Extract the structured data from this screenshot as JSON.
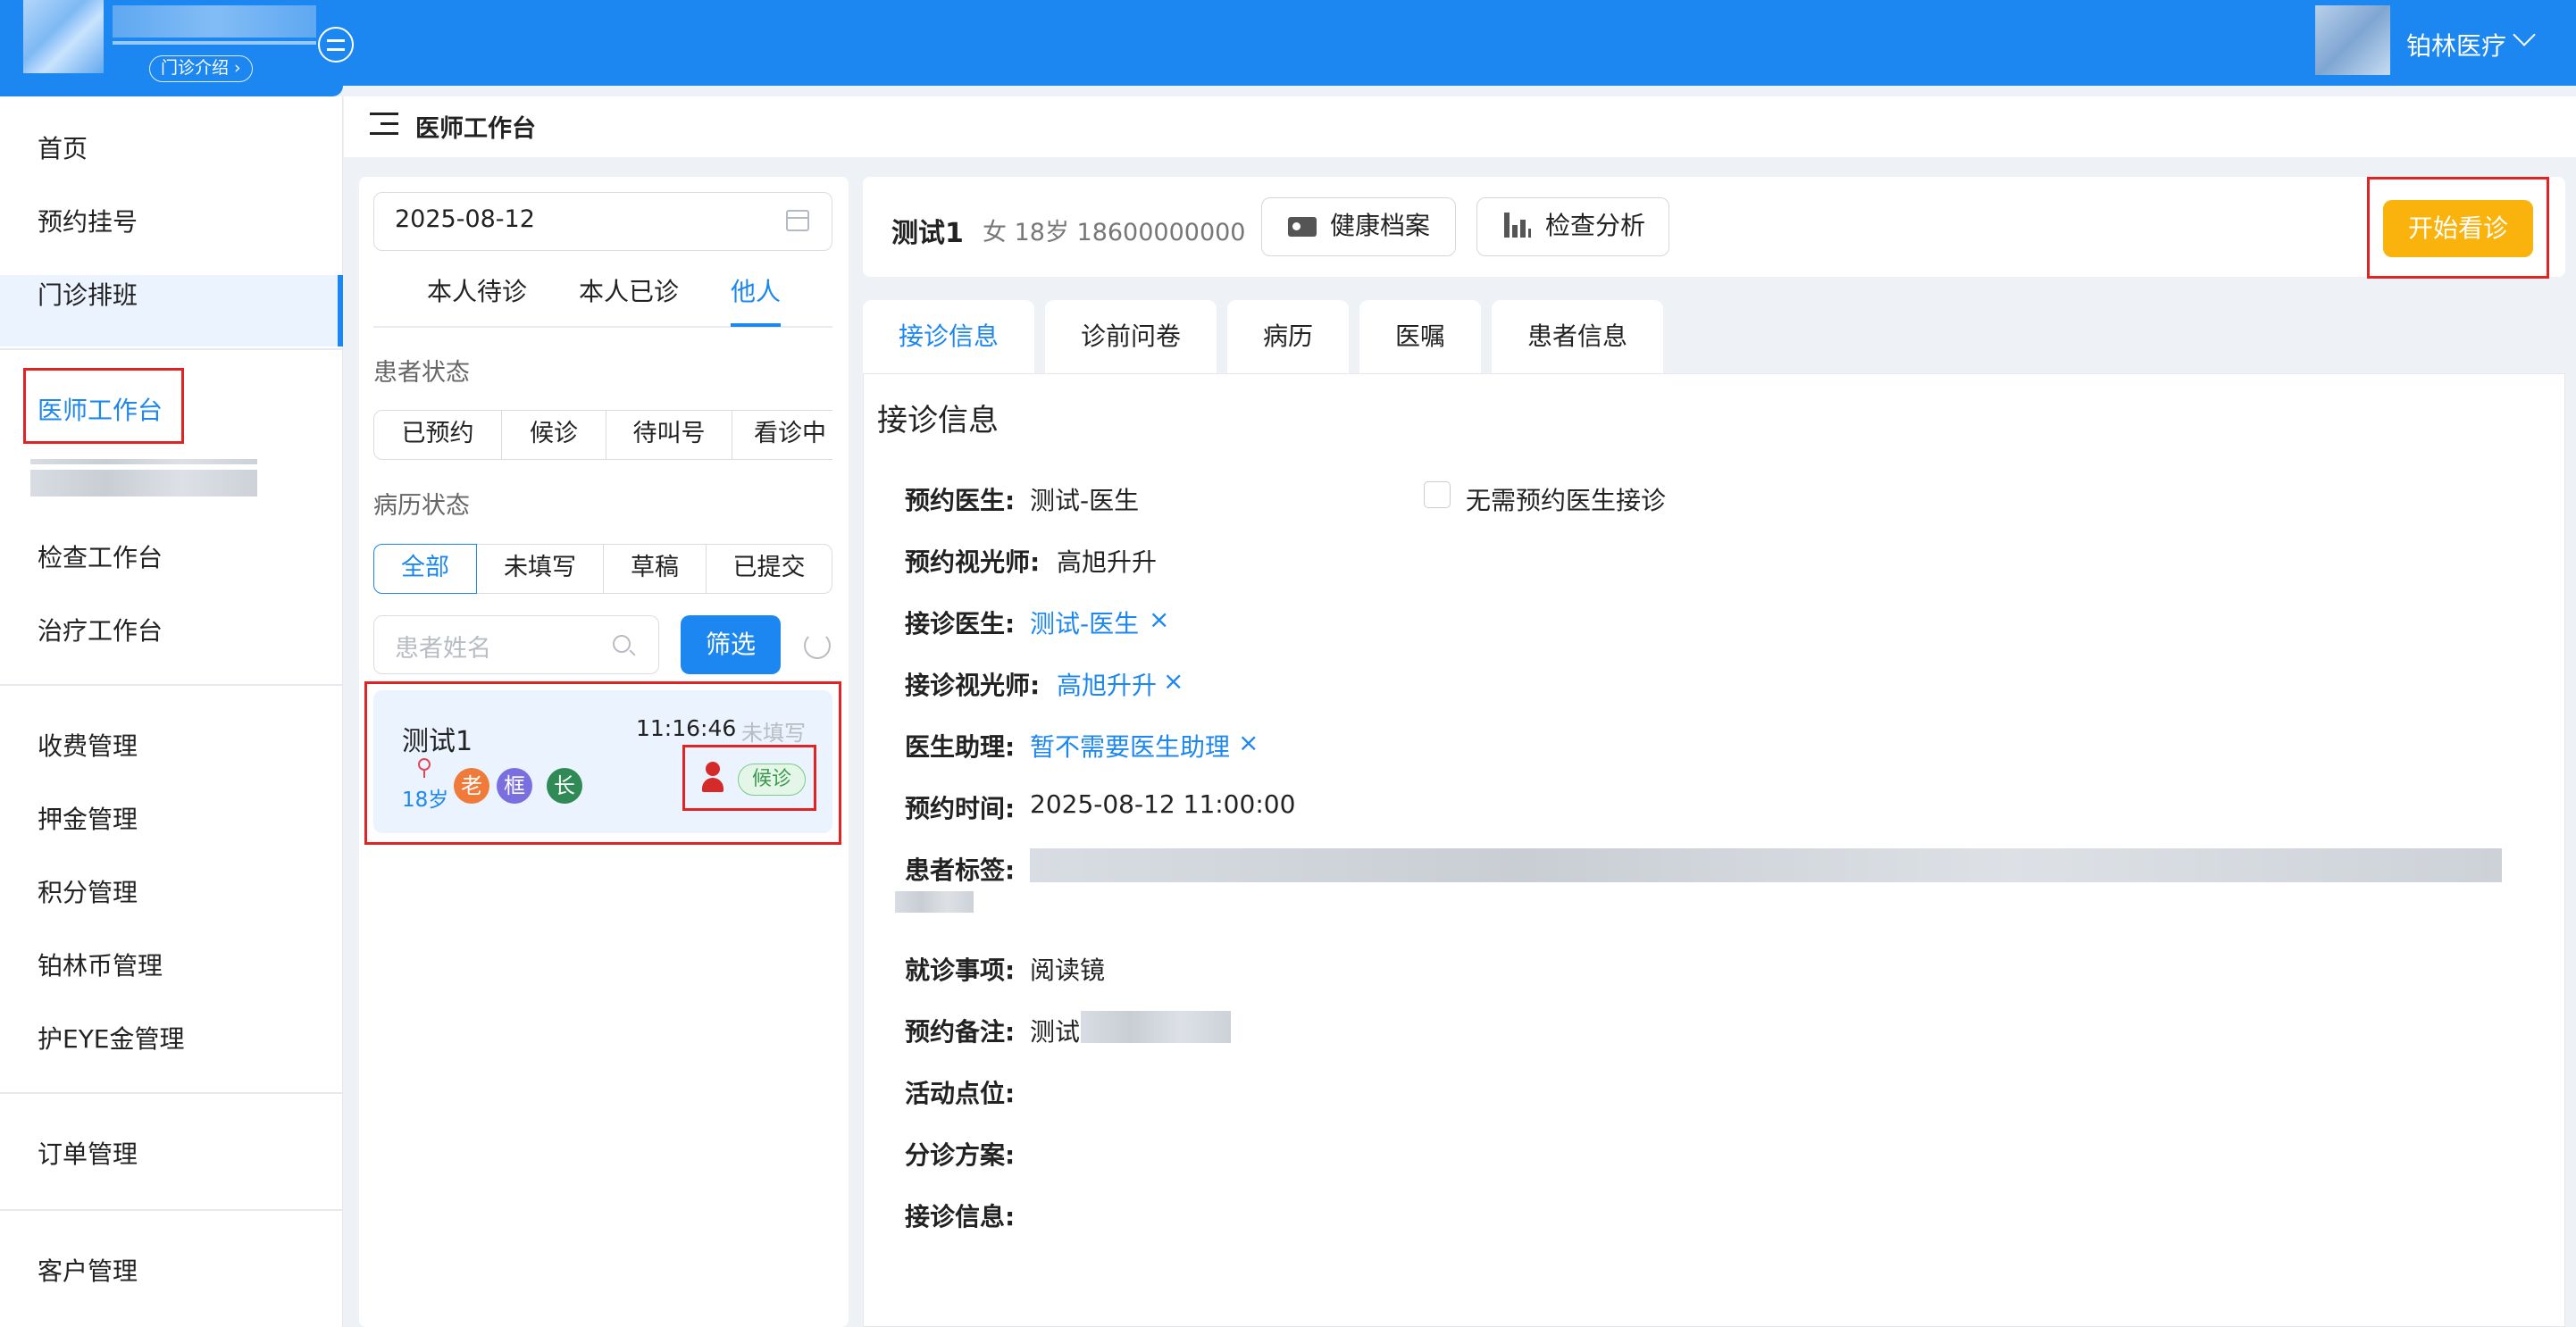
{
  "header": {
    "clinic_intro": "门诊介绍",
    "org_name": "铂林医疗"
  },
  "sidebar": {
    "items": [
      "首页",
      "预约挂号",
      "门诊排班",
      "医师工作台",
      "检查工作台",
      "治疗工作台",
      "收费管理",
      "押金管理",
      "积分管理",
      "铂林币管理",
      "护EYE金管理",
      "订单管理",
      "客户管理"
    ],
    "active": "医师工作台"
  },
  "page": {
    "title": "医师工作台"
  },
  "patient_list": {
    "date": "2025-08-12",
    "tabs": [
      "本人待诊",
      "本人已诊",
      "他人"
    ],
    "active_tab": "他人",
    "patient_status_label": "患者状态",
    "patient_status_options": [
      "已预约",
      "候诊",
      "待叫号",
      "看诊中"
    ],
    "record_status_label": "病历状态",
    "record_status_options": [
      "全部",
      "未填写",
      "草稿",
      "已提交"
    ],
    "record_status_active": "全部",
    "search_placeholder": "患者姓名",
    "filter_label": "筛选",
    "patients": [
      {
        "name": "测试1",
        "time": "11:16:46",
        "record_state": "未填写",
        "age": "18岁",
        "tags": [
          "老",
          "框",
          "长"
        ],
        "status": "候诊"
      }
    ]
  },
  "patient_header": {
    "name": "测试1",
    "info": "女 18岁 18600000000",
    "health_record_label": "健康档案",
    "exam_analysis_label": "检查分析",
    "start_label": "开始看诊"
  },
  "main_tabs": [
    "接诊信息",
    "诊前问卷",
    "病历",
    "医嘱",
    "患者信息"
  ],
  "active_main_tab": "接诊信息",
  "reception": {
    "title": "接诊信息",
    "fields": {
      "appt_doctor": {
        "label": "预约医生:",
        "value": "测试-医生"
      },
      "no_appt_doctor": "无需预约医生接诊",
      "appt_optometrist": {
        "label": "预约视光师:",
        "value": "高旭升升"
      },
      "reception_doctor": {
        "label": "接诊医生:",
        "value": "测试-医生"
      },
      "reception_optometrist": {
        "label": "接诊视光师:",
        "value": "高旭升升"
      },
      "doctor_assistant": {
        "label": "医生助理:",
        "value": "暂不需要医生助理"
      },
      "appt_time": {
        "label": "预约时间:",
        "value": "2025-08-12 11:00:00"
      },
      "patient_tags": {
        "label": "患者标签:"
      },
      "visit_item": {
        "label": "就诊事项:",
        "value": "阅读镜"
      },
      "appt_note": {
        "label": "预约备注:",
        "value": "测试"
      },
      "activity_point": {
        "label": "活动点位:"
      },
      "triage_plan": {
        "label": "分诊方案:"
      },
      "reception_info": {
        "label": "接诊信息:"
      }
    },
    "remove_mark": "×"
  },
  "colors": {
    "brand": "#1c87f0",
    "start_button": "#fab20c",
    "annotation": "#e02424",
    "status_green": "#3a9a4c",
    "tag_orange": "#f07a3a",
    "tag_purple": "#7b6fe0",
    "tag_green": "#2f8a56"
  }
}
